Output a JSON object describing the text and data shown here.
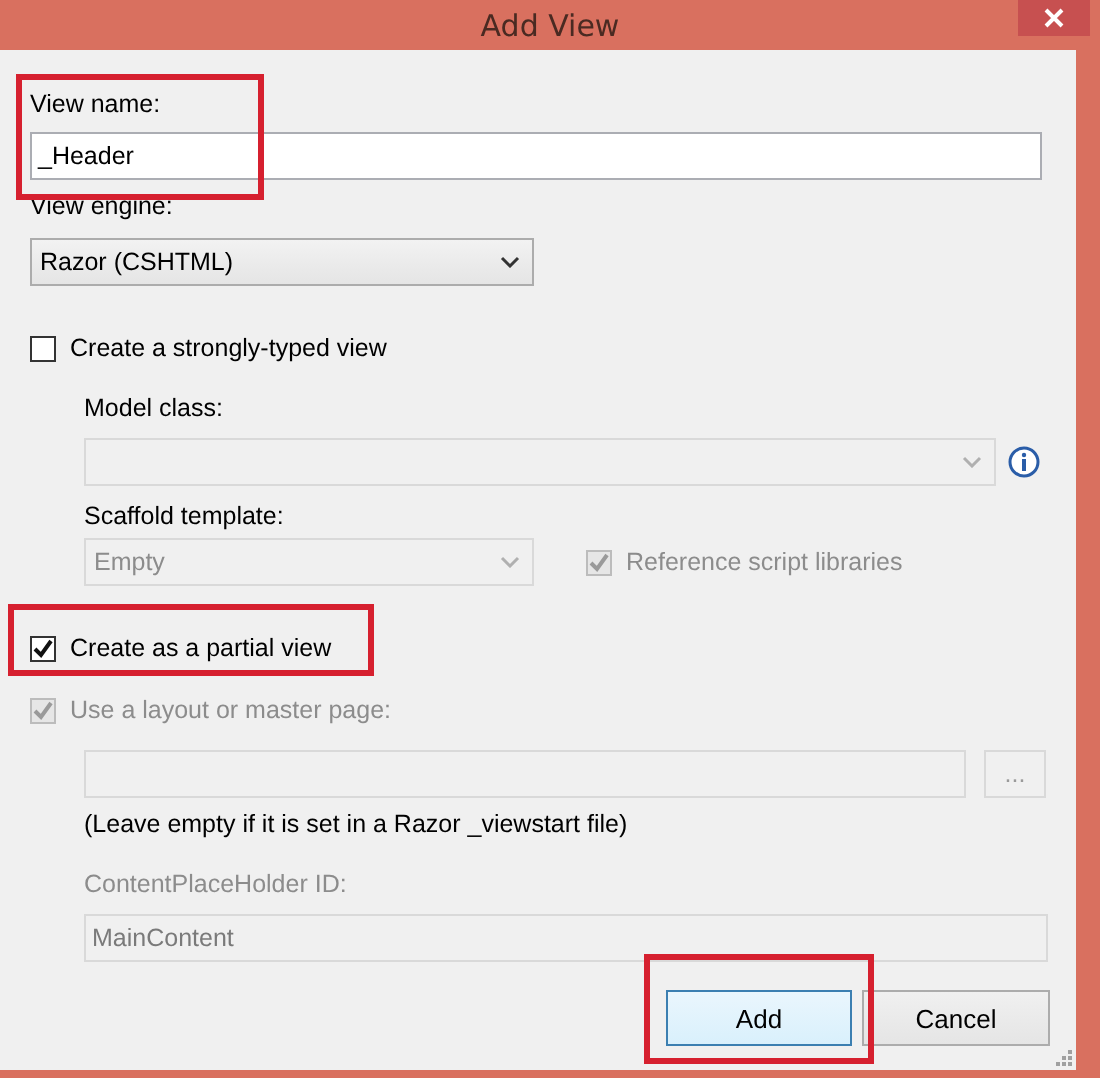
{
  "window": {
    "title": "Add View"
  },
  "view_name": {
    "label": "View name:",
    "value": "_Header",
    "highlighted": true
  },
  "view_engine": {
    "label": "View engine:",
    "value": "Razor (CSHTML)"
  },
  "strongly_typed": {
    "label": "Create a strongly-typed view",
    "checked": false,
    "disabled": false
  },
  "model_class": {
    "label": "Model class:",
    "disabled": true
  },
  "scaffold_template": {
    "label": "Scaffold template:",
    "value": "Empty",
    "disabled": true
  },
  "reference_scripts": {
    "label": "Reference script libraries",
    "checked": true,
    "disabled": true
  },
  "partial_view": {
    "label": "Create as a partial view",
    "checked": true,
    "disabled": false,
    "highlighted": true
  },
  "use_layout": {
    "label": "Use a layout or master page:",
    "checked": true,
    "disabled": true
  },
  "layout_path": {
    "disabled": true,
    "browse_label": "..."
  },
  "layout_hint": "(Leave empty if it is set in a Razor _viewstart file)",
  "placeholder_id": {
    "label": "ContentPlaceHolder ID:",
    "value": "MainContent",
    "disabled": true
  },
  "buttons": [
    {
      "label": "Add",
      "default": true,
      "highlighted": true
    },
    {
      "label": "Cancel",
      "default": false,
      "highlighted": false
    }
  ]
}
